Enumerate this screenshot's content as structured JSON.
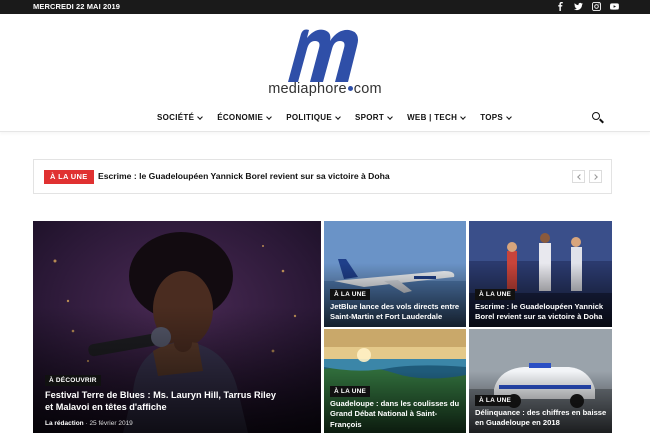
{
  "topbar": {
    "date": "MERCREDI 22 MAI 2019",
    "socials": [
      "facebook-icon",
      "twitter-icon",
      "instagram-icon",
      "youtube-icon"
    ]
  },
  "brand": {
    "name_left": "mediaphore",
    "name_right": "com",
    "color": "#2f4fa8"
  },
  "nav": {
    "items": [
      "SOCIÉTÉ",
      "ÉCONOMIE",
      "POLITIQUE",
      "SPORT",
      "WEB | TECH",
      "TOPS"
    ]
  },
  "ticker": {
    "badge": "À LA UNE",
    "headline": "Escrime : le Guadeloupéen Yannick Borel revient sur sa victoire à Doha"
  },
  "featured": {
    "category": "À DÉCOUVRIR",
    "title": "Festival Terre de Blues : Ms. Lauryn Hill, Tarrus Riley et Malavoi en têtes d'affiche",
    "author": "La rédaction",
    "date": "25 février 2019"
  },
  "cards": [
    {
      "category": "À LA UNE",
      "title": "JetBlue lance des vols directs entre Saint-Martin et Fort Lauderdale"
    },
    {
      "category": "À LA UNE",
      "title": "Escrime : le Guadeloupéen Yannick Borel revient sur sa victoire à Doha"
    },
    {
      "category": "À LA UNE",
      "title": "Guadeloupe : dans les coulisses du Grand Débat National à Saint-François"
    },
    {
      "category": "À LA UNE",
      "title": "Délinquance : des chiffres en baisse en Guadeloupe en 2018"
    }
  ],
  "colors": {
    "accent": "#e03131",
    "topbar": "#1a1a1a"
  }
}
